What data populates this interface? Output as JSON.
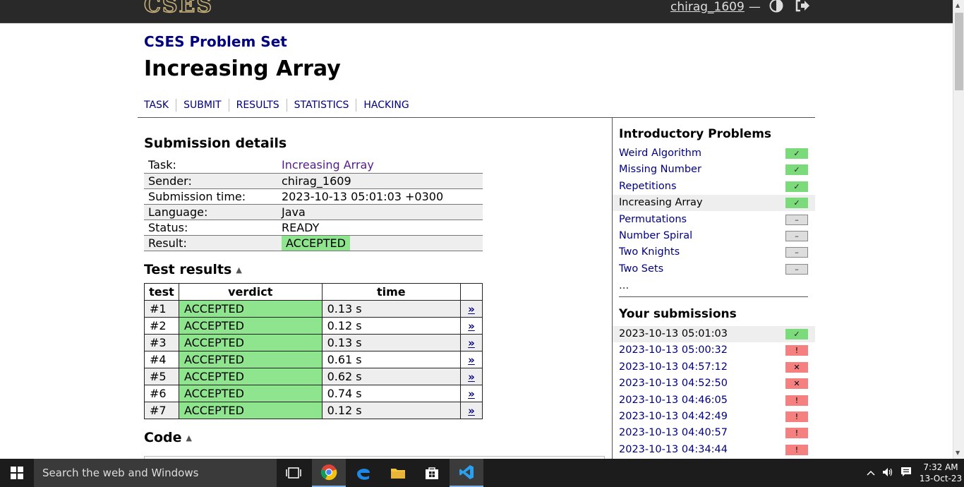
{
  "header": {
    "logo": "CSES",
    "username": "chirag_1609",
    "dash": "—"
  },
  "page": {
    "section_title": "CSES Problem Set",
    "problem_title": "Increasing Array"
  },
  "nav": [
    "TASK",
    "SUBMIT",
    "RESULTS",
    "STATISTICS",
    "HACKING"
  ],
  "submission": {
    "heading": "Submission details",
    "rows": [
      {
        "key": "Task:",
        "value": "Increasing Array"
      },
      {
        "key": "Sender:",
        "value": "chirag_1609"
      },
      {
        "key": "Submission time:",
        "value": "2023-10-13 05:01:03 +0300"
      },
      {
        "key": "Language:",
        "value": "Java"
      },
      {
        "key": "Status:",
        "value": "READY"
      },
      {
        "key": "Result:",
        "value": "ACCEPTED"
      }
    ]
  },
  "tests": {
    "heading": "Test results",
    "headers": [
      "test",
      "verdict",
      "time"
    ],
    "link_glyph": "»",
    "rows": [
      {
        "test": "#1",
        "verdict": "ACCEPTED",
        "time": "0.13 s"
      },
      {
        "test": "#2",
        "verdict": "ACCEPTED",
        "time": "0.12 s"
      },
      {
        "test": "#3",
        "verdict": "ACCEPTED",
        "time": "0.13 s"
      },
      {
        "test": "#4",
        "verdict": "ACCEPTED",
        "time": "0.61 s"
      },
      {
        "test": "#5",
        "verdict": "ACCEPTED",
        "time": "0.62 s"
      },
      {
        "test": "#6",
        "verdict": "ACCEPTED",
        "time": "0.74 s"
      },
      {
        "test": "#7",
        "verdict": "ACCEPTED",
        "time": "0.12 s"
      }
    ]
  },
  "code": {
    "heading": "Code"
  },
  "sidebar": {
    "problems_heading": "Introductory Problems",
    "problems": [
      {
        "label": "Weird Algorithm",
        "status": "ok",
        "mark": "✓"
      },
      {
        "label": "Missing Number",
        "status": "ok",
        "mark": "✓"
      },
      {
        "label": "Repetitions",
        "status": "ok",
        "mark": "✓"
      },
      {
        "label": "Increasing Array",
        "status": "ok",
        "mark": "✓",
        "current": true
      },
      {
        "label": "Permutations",
        "status": "none",
        "mark": "–"
      },
      {
        "label": "Number Spiral",
        "status": "none",
        "mark": "–"
      },
      {
        "label": "Two Knights",
        "status": "none",
        "mark": "–"
      },
      {
        "label": "Two Sets",
        "status": "none",
        "mark": "–"
      }
    ],
    "more": "...",
    "submissions_heading": "Your submissions",
    "submissions": [
      {
        "label": "2023-10-13 05:01:03",
        "status": "ok",
        "mark": "✓",
        "current": true
      },
      {
        "label": "2023-10-13 05:00:32",
        "status": "err",
        "mark": "!"
      },
      {
        "label": "2023-10-13 04:57:12",
        "status": "err",
        "mark": "✕"
      },
      {
        "label": "2023-10-13 04:52:50",
        "status": "err",
        "mark": "✕"
      },
      {
        "label": "2023-10-13 04:46:05",
        "status": "err",
        "mark": "!"
      },
      {
        "label": "2023-10-13 04:42:49",
        "status": "err",
        "mark": "!"
      },
      {
        "label": "2023-10-13 04:40:57",
        "status": "err",
        "mark": "!"
      },
      {
        "label": "2023-10-13 04:34:44",
        "status": "err",
        "mark": "!"
      }
    ]
  },
  "taskbar": {
    "search_placeholder": "Search the web and Windows",
    "time": "7:32 AM",
    "date": "13-Oct-23"
  },
  "colors": {
    "accent": "#000080",
    "accepted": "#8ee58e",
    "error": "#f58080"
  }
}
